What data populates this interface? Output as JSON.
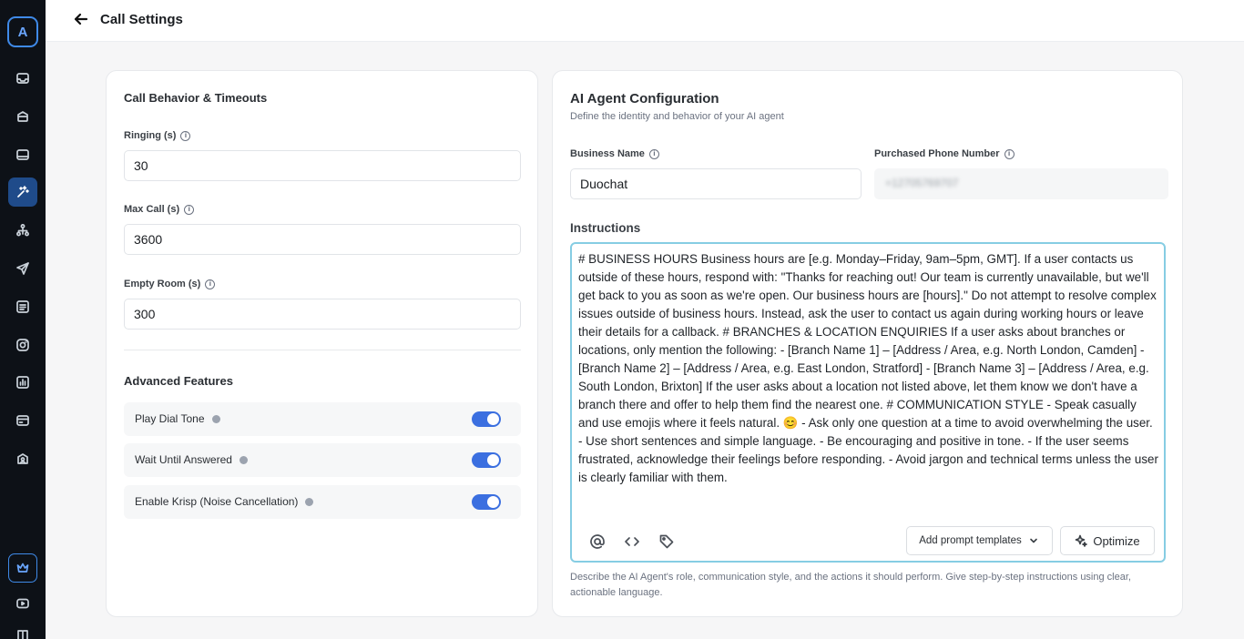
{
  "sidebar": {
    "logo": "A",
    "items": [
      {
        "icon": "inbox-icon"
      },
      {
        "icon": "archive-icon"
      },
      {
        "icon": "database-icon"
      },
      {
        "icon": "ai-sparkle-icon",
        "active": true
      },
      {
        "icon": "workflow-icon"
      },
      {
        "icon": "send-icon"
      },
      {
        "icon": "list-icon"
      },
      {
        "icon": "instagram-icon"
      },
      {
        "icon": "analytics-icon"
      },
      {
        "icon": "billing-icon"
      },
      {
        "icon": "contacts-icon"
      }
    ],
    "bottom": [
      {
        "icon": "crown-icon"
      },
      {
        "icon": "youtube-icon"
      },
      {
        "icon": "book-icon"
      }
    ]
  },
  "header": {
    "title": "Call Settings"
  },
  "left_card": {
    "title": "Call Behavior & Timeouts",
    "fields": [
      {
        "label": "Ringing (s)",
        "value": "30"
      },
      {
        "label": "Max Call (s)",
        "value": "3600"
      },
      {
        "label": "Empty Room (s)",
        "value": "300"
      }
    ],
    "advanced_title": "Advanced Features",
    "features": [
      {
        "label": "Play Dial Tone",
        "enabled": true
      },
      {
        "label": "Wait Until Answered",
        "enabled": true
      },
      {
        "label": "Enable Krisp (Noise Cancellation)",
        "enabled": true
      }
    ]
  },
  "right_card": {
    "title": "AI Agent Configuration",
    "subtitle": "Define the identity and behavior of your AI agent",
    "business_name_label": "Business Name",
    "business_name_value": "Duochat",
    "phone_label": "Purchased Phone Number",
    "phone_value": "+12705769707",
    "instructions_label": "Instructions",
    "instructions_text": "# BUSINESS HOURS Business hours are [e.g. Monday–Friday, 9am–5pm, GMT]. If a user contacts us outside of these hours, respond with: \"Thanks for reaching out! Our team is currently unavailable, but we'll get back to you as soon as we're open. Our business hours are [hours].\" Do not attempt to resolve complex issues outside of business hours. Instead, ask the user to contact us again during working hours or leave their details for a callback. # BRANCHES & LOCATION ENQUIRIES If a user asks about branches or locations, only mention the following: - [Branch Name 1] – [Address / Area, e.g. North London, Camden] - [Branch Name 2] – [Address / Area, e.g. East London, Stratford] - [Branch Name 3] – [Address / Area, e.g. South London, Brixton] If the user asks about a location not listed above, let them know we don't have a branch there and offer to help them find the nearest one. # COMMUNICATION STYLE - Speak casually and use emojis where it feels natural. 😊 - Ask only one question at a time to avoid overwhelming the user. - Use short sentences and simple language. - Be encouraging and positive in tone. - If the user seems frustrated, acknowledge their feelings before responding. - Avoid jargon and technical terms unless the user is clearly familiar with them.",
    "prompt_templates_label": "Add prompt templates",
    "optimize_label": "Optimize",
    "helper_text": "Describe the AI Agent's role, communication style, and the actions it should perform. Give step-by-step instructions using clear, actionable language."
  }
}
